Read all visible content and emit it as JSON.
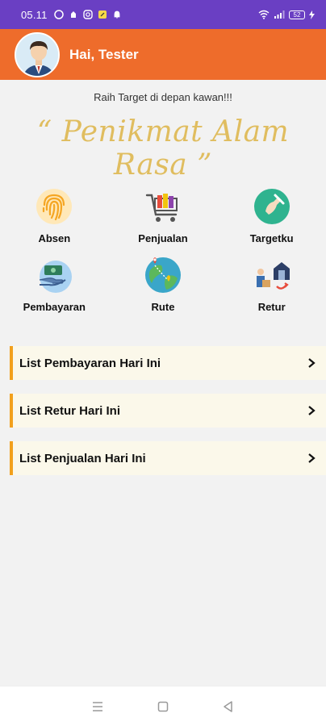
{
  "status_bar": {
    "time": "05.11",
    "battery": "52"
  },
  "header": {
    "greeting": "Hai, Tester"
  },
  "motto": "Raih Target di depan kawan!!!",
  "brand": "“ Penikmat Alam Rasa ”",
  "menu": [
    {
      "label": "Absen",
      "icon": "fingerprint-icon"
    },
    {
      "label": "Penjualan",
      "icon": "shopping-cart-icon"
    },
    {
      "label": "Targetku",
      "icon": "target-icon"
    },
    {
      "label": "Pembayaran",
      "icon": "payment-icon"
    },
    {
      "label": "Rute",
      "icon": "globe-route-icon"
    },
    {
      "label": "Retur",
      "icon": "return-icon"
    }
  ],
  "lists": [
    {
      "label": "List Pembayaran Hari Ini"
    },
    {
      "label": "List Retur Hari Ini"
    },
    {
      "label": "List Penjualan Hari Ini"
    }
  ],
  "colors": {
    "status_bar": "#6a3fc3",
    "header": "#ee6c2b",
    "brand": "#e0bd5f",
    "card_accent": "#f2a01c"
  }
}
